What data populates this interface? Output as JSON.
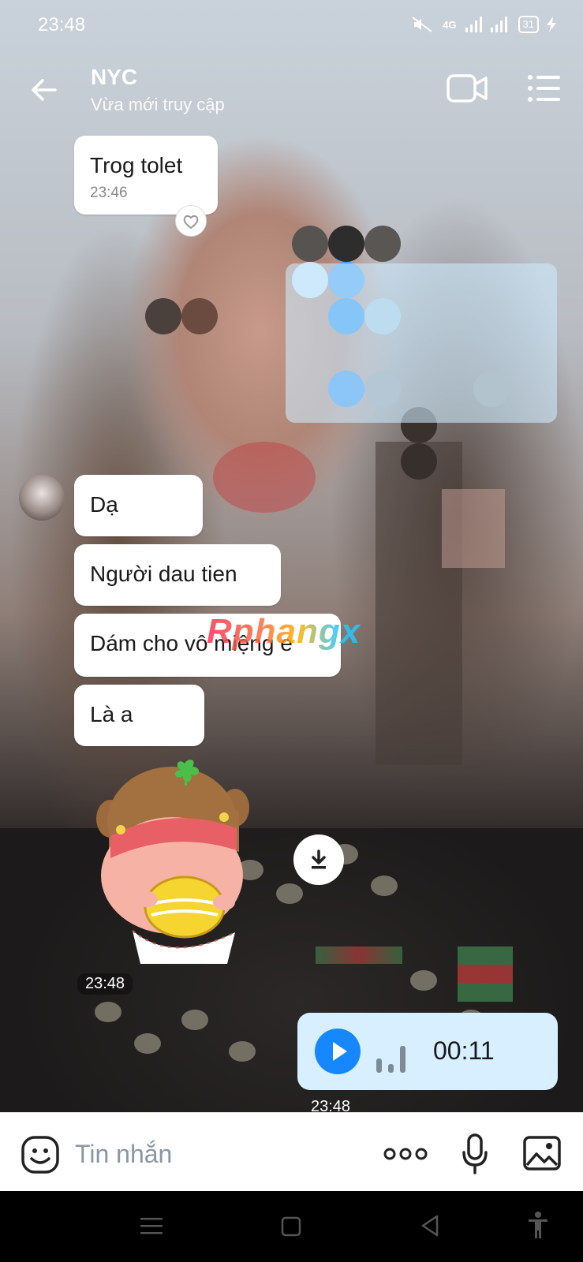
{
  "status_bar": {
    "time": "23:48",
    "network": "4G",
    "battery": "31"
  },
  "header": {
    "title": "NYC",
    "subtitle": "Vừa mới truy cập"
  },
  "messages": [
    {
      "text": "Trog tolet",
      "time": "23:46"
    },
    {
      "text": "Dạ"
    },
    {
      "text": "Người dau tien"
    },
    {
      "text": "Dám cho vô miệng e"
    },
    {
      "text": "Là a"
    }
  ],
  "sticker_time": "23:48",
  "voice_message": {
    "duration": "00:11",
    "time": "23:48"
  },
  "watermark": "Rphangx",
  "input": {
    "placeholder": "Tin nhắn"
  },
  "colors": {
    "accent": "#1787ff",
    "voice_bubble": "#d7efff",
    "bubble": "#ffffff"
  }
}
